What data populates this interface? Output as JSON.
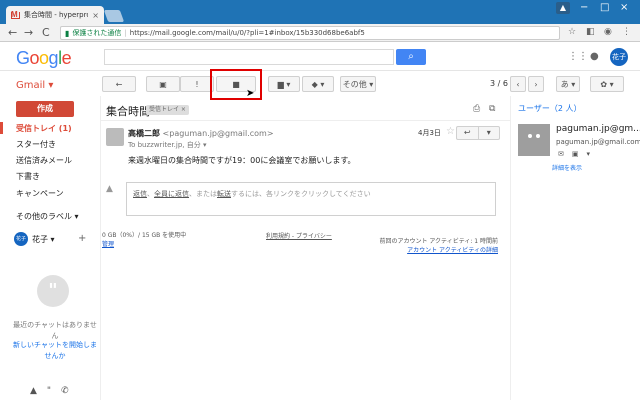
{
  "browser": {
    "tab_title": "集合時間 - hyperpro.jp",
    "tab_close": "×",
    "secure_label": "保護された通信",
    "url": "https://mail.google.com/mail/u/0/?pli=1#inbox/15b330d68be6abf5",
    "back": "←",
    "forward": "→",
    "reload": "C",
    "star": "☆",
    "user_tag": "▲",
    "win_min": "−",
    "win_max": "□",
    "win_close": "×"
  },
  "header": {
    "logo_letters": [
      {
        "char": "G",
        "color": "#4285f4"
      },
      {
        "char": "o",
        "color": "#ea4335"
      },
      {
        "char": "o",
        "color": "#fbbc05"
      },
      {
        "char": "g",
        "color": "#4285f4"
      },
      {
        "char": "l",
        "color": "#34a853"
      },
      {
        "char": "e",
        "color": "#ea4335"
      }
    ],
    "search_value": "",
    "search_icon": "⌕",
    "avatar_label": "花子",
    "apps_icon": "⋮⋮",
    "notif_icon": "●"
  },
  "toolbar": {
    "gmail_label": "Gmail ▾",
    "back_icon": "←",
    "archive_icon": "▣",
    "spam_icon": "!",
    "delete_icon": "■",
    "move_icon": "▆ ▾",
    "label_icon": "◆ ▾",
    "more_label": "その他 ▾",
    "pager": "3 / 6",
    "prev_icon": "‹",
    "next_icon": "›",
    "input_tool": "あ ▾",
    "settings_icon": "✿ ▾",
    "cursor": "➤"
  },
  "sidebar": {
    "compose": "作成",
    "items": [
      {
        "label": "受信トレイ (1)",
        "active": true
      },
      {
        "label": "スター付き"
      },
      {
        "label": "送信済みメール"
      },
      {
        "label": "下書き"
      },
      {
        "label": "キャンペーン"
      },
      {
        "label": "その他のラベル ▾"
      }
    ],
    "hangout_user": "花子 ▾",
    "hangout_avatar": "花子",
    "hangout_add": "+",
    "hangout_bubble": "\"",
    "no_chat": "最近のチャットはありません",
    "start_chat": "新しいチャットを開始しませんか",
    "bottom": [
      "▲",
      "\"",
      "✆"
    ]
  },
  "conversation": {
    "subject": "集合時間",
    "label": "受信トレイ ×",
    "print_icon": "⎙",
    "newwin_icon": "⧉",
    "sender_name": "高橋二郎",
    "sender_email": "<paguman.jp@gmail.com>",
    "to_line": "To buzzwriter.jp, 自分 ▾",
    "date": "4月3日",
    "star_icon": "☆",
    "reply_icon": "↩",
    "reply_more": "▾",
    "body": "来週水曜日の集合時間ですが19：00に会議室でお願いします。",
    "reply_box_icon": "▲",
    "reply_link1": "返信",
    "reply_link2": "全員に返信",
    "reply_mid": "、",
    "reply_mid2": "、または",
    "reply_link3": "転送",
    "reply_tail": "するには、各リンクをクリックしてください",
    "storage": "0 GB（0%）/ 15 GB を使用中",
    "manage": "管理",
    "terms": "利用規約 - プライバシー",
    "activity": "前回のアカウント アクティビティ: 1 時間前",
    "activity_detail": "アカウント アクティビティの詳細"
  },
  "people": {
    "title": "ユーザー（2 人）",
    "name": "paguman.jp@gm...",
    "email": "paguman.jp@gmail.com",
    "actions": [
      "✉",
      "▣",
      "▾"
    ],
    "show_details": "詳細を表示"
  }
}
